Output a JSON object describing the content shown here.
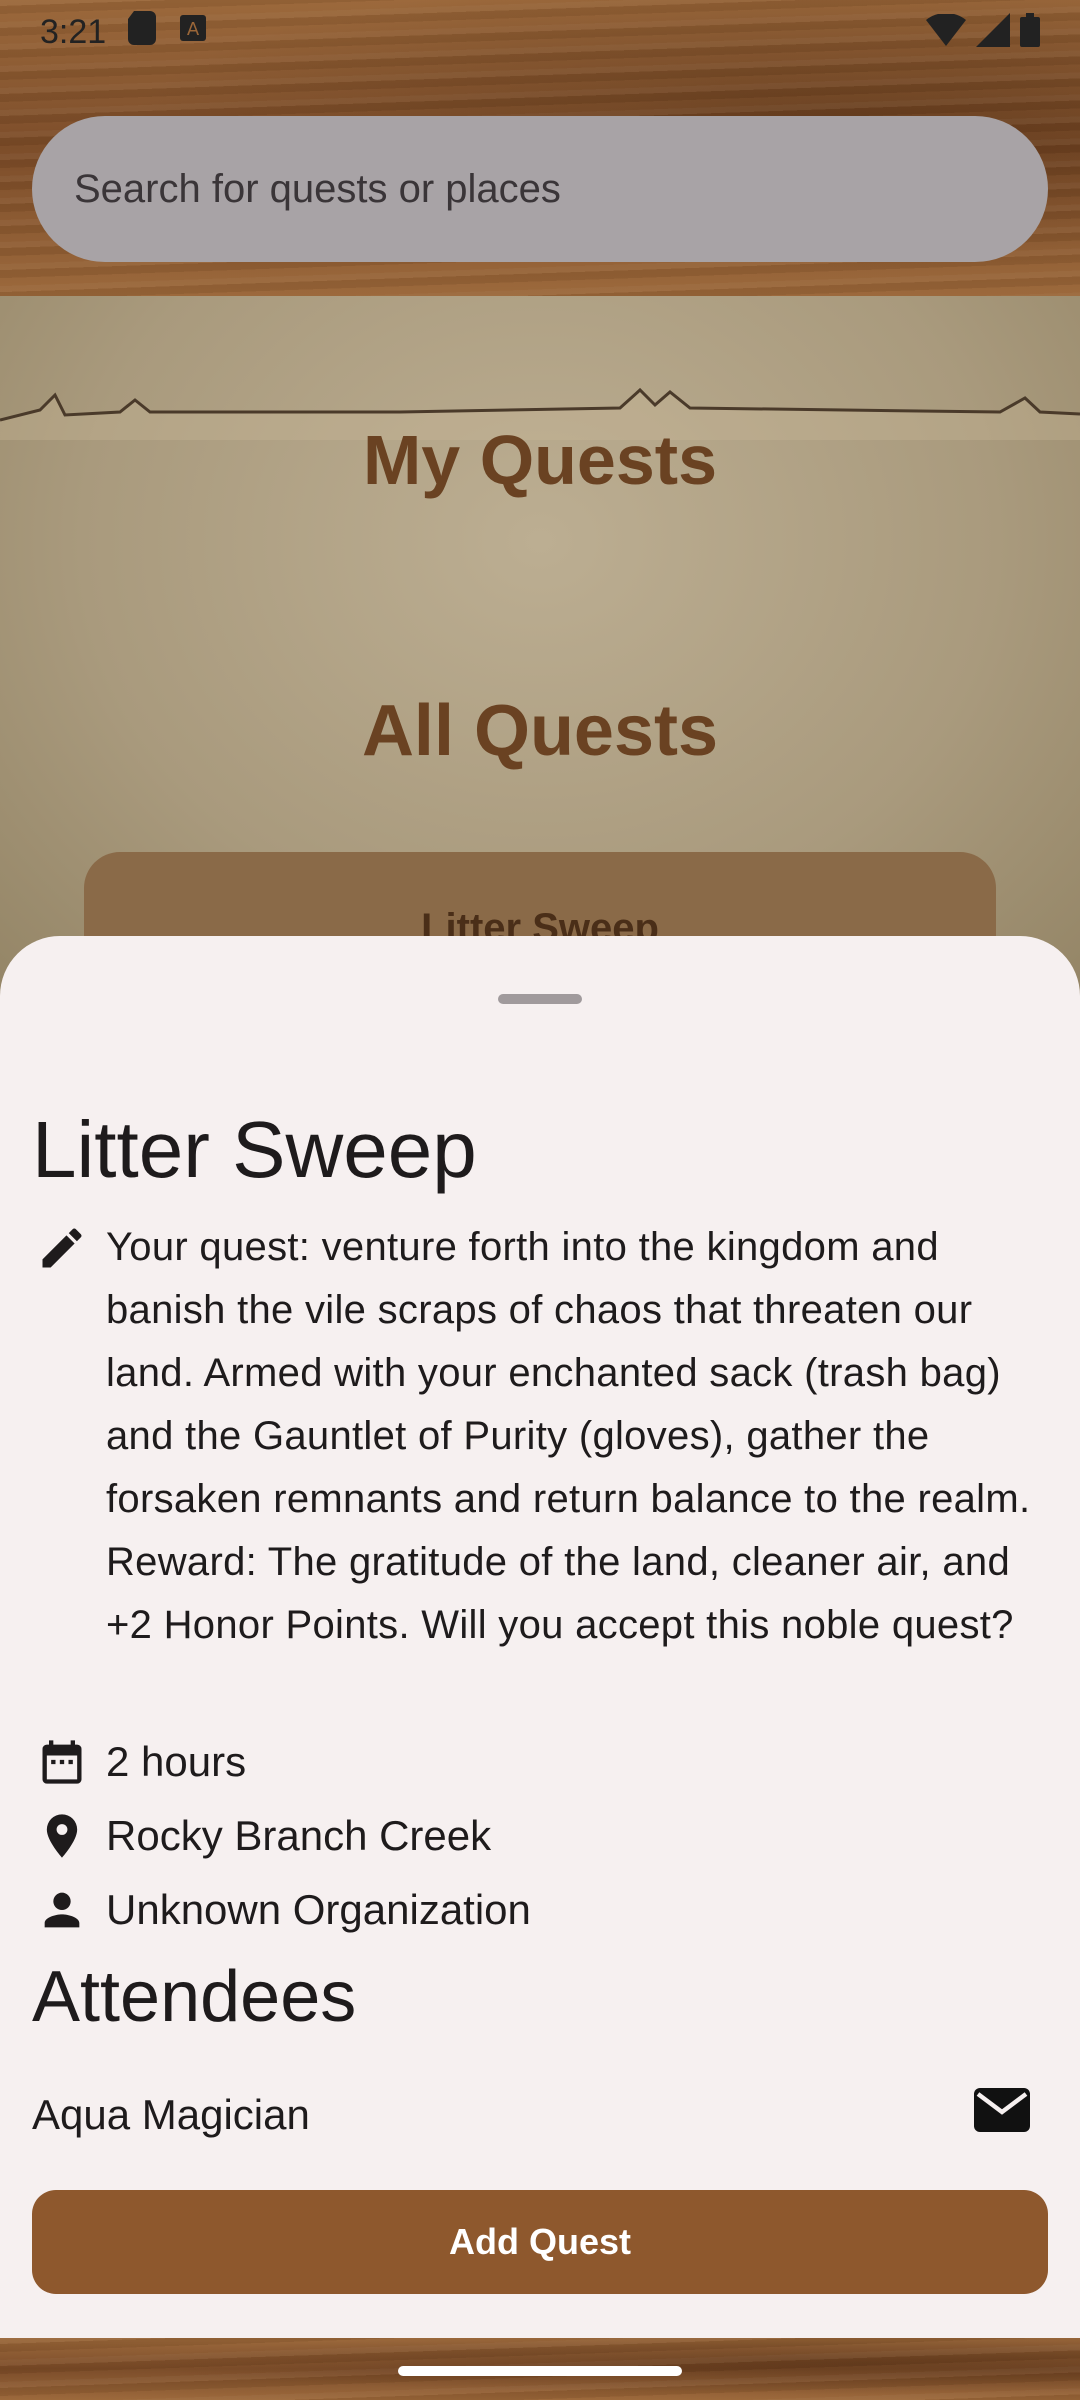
{
  "status_bar": {
    "time": "3:21"
  },
  "search": {
    "placeholder": "Search for quests or places"
  },
  "background": {
    "my_quests_heading": "My Quests",
    "all_quests_heading": "All Quests",
    "card_peek_title": "Litter Sweep"
  },
  "sheet": {
    "title": "Litter Sweep",
    "description": "Your quest: venture forth into the kingdom and banish the vile scraps of chaos that threaten our land. Armed with your enchanted sack (trash bag) and the Gauntlet of Purity (gloves), gather the forsaken remnants and return balance to the realm. Reward: The gratitude of the land, cleaner air, and +2 Honor Points. Will you accept this noble quest?",
    "duration": "2 hours",
    "location": "Rocky Branch Creek",
    "organization": "Unknown Organization",
    "attendees_heading": "Attendees",
    "attendees": [
      {
        "name": "Aqua Magician"
      }
    ],
    "add_button_label": "Add Quest"
  },
  "icons": {
    "description": "pencil-icon",
    "duration": "calendar-icon",
    "location": "location-pin-icon",
    "organization": "person-icon",
    "message": "mail-icon"
  },
  "colors": {
    "accent": "#8e582d",
    "heading_brown": "#6a4222",
    "sheet_bg": "#f6f0f0"
  }
}
